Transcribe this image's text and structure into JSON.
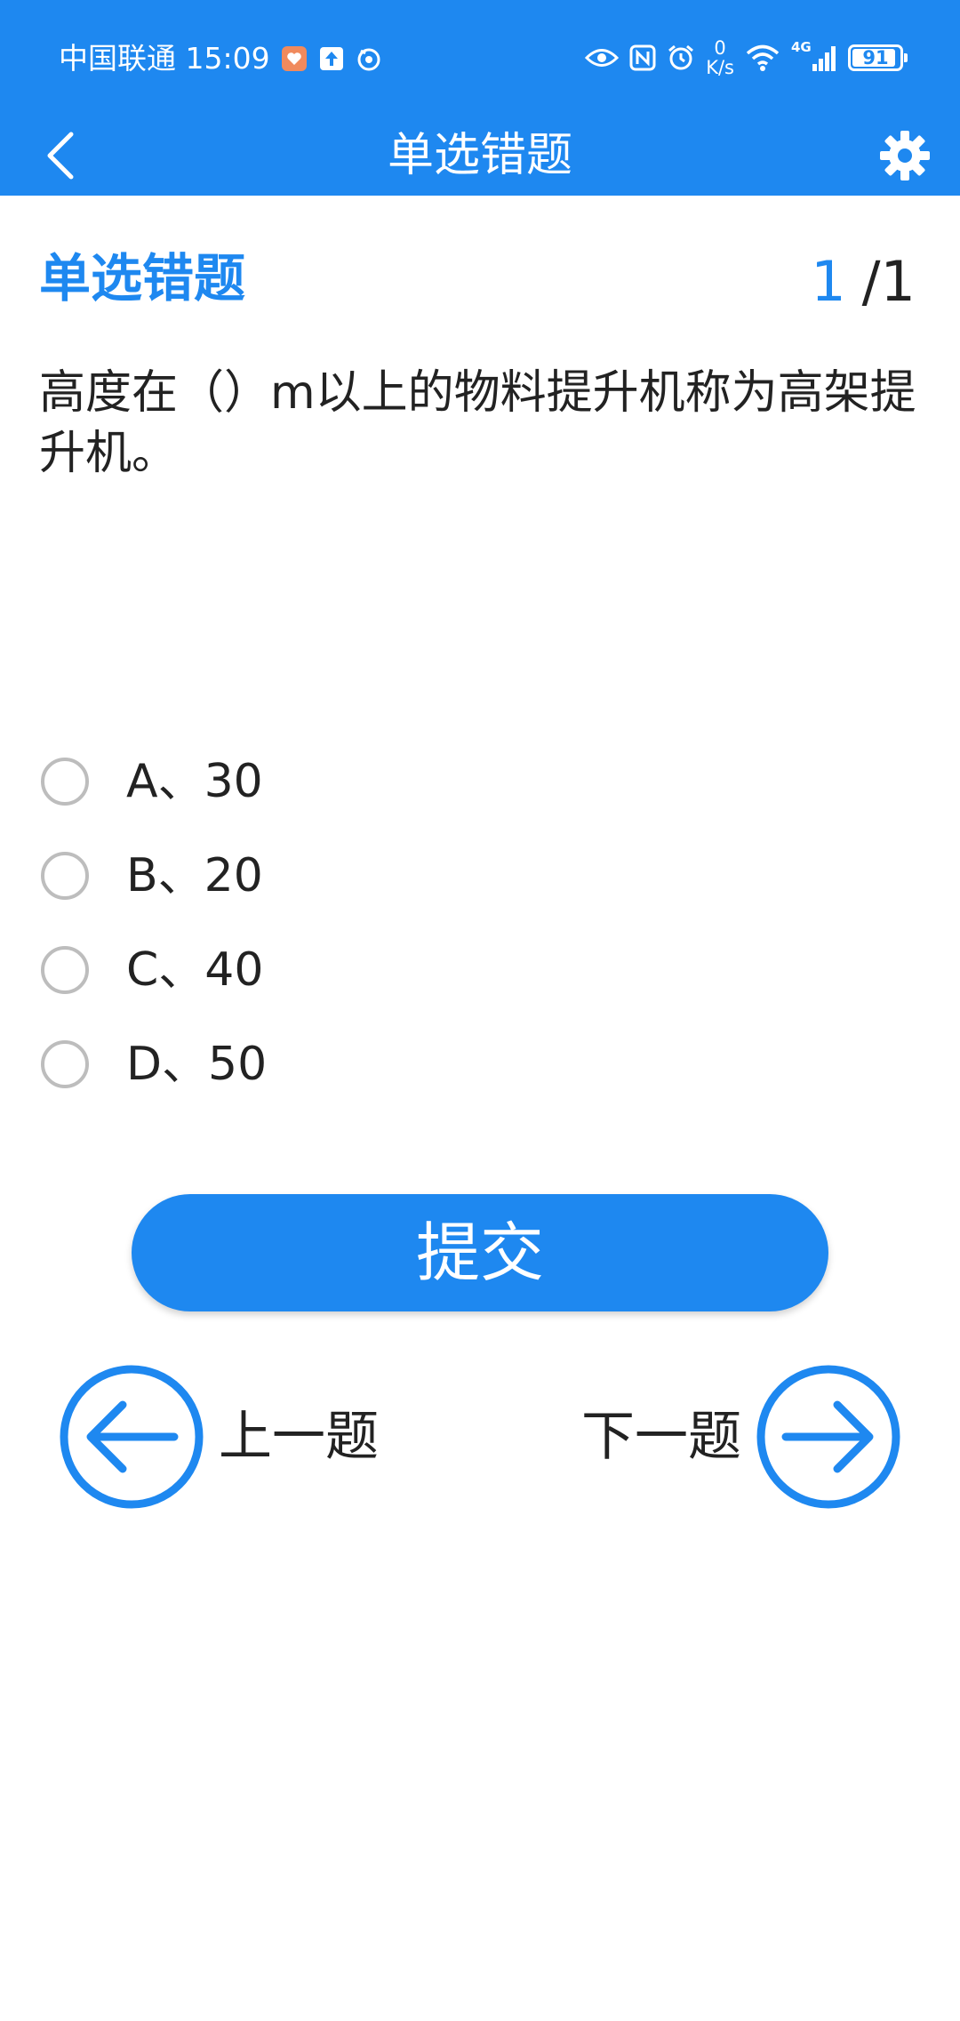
{
  "status_bar": {
    "carrier_time": "中国联通 15:09",
    "net_speed_value": "0",
    "net_speed_unit": "K/s",
    "network": "4G",
    "battery": "91"
  },
  "app_bar": {
    "title": "单选错题"
  },
  "content": {
    "section_title": "单选错题",
    "counter_current": "1",
    "counter_total": "/1",
    "question": "高度在（）m以上的物料提升机称为高架提升机。",
    "options": [
      {
        "label": "A、30"
      },
      {
        "label": "B、20"
      },
      {
        "label": "C、40"
      },
      {
        "label": "D、50"
      }
    ],
    "submit_label": "提交",
    "prev_label": "上一题",
    "next_label": "下一题"
  },
  "colors": {
    "accent": "#1e88f0",
    "text": "#222222",
    "radio_border": "#bdbdbd",
    "background": "#ffffff"
  },
  "icons": {
    "back": "chevron-left-icon",
    "settings": "gear-icon",
    "prev": "arrow-left-circle-icon",
    "next": "arrow-right-circle-icon"
  }
}
